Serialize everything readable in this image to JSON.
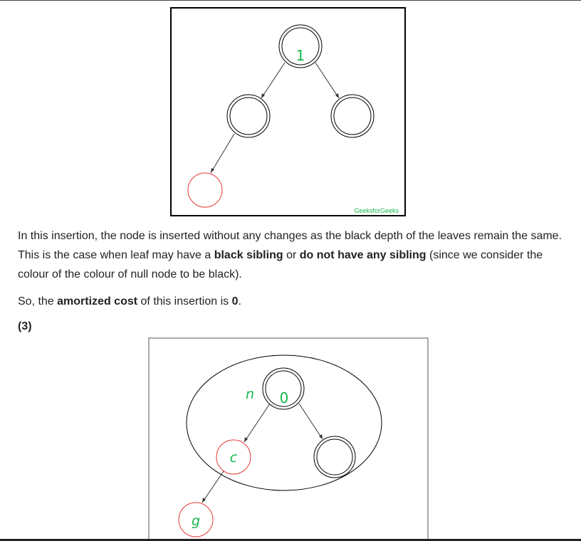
{
  "figure1": {
    "root_label": "1",
    "watermark": "GeeksforGeeks",
    "colors": {
      "node": "#000000",
      "red_node": "#e53935",
      "label": "#17b84a"
    }
  },
  "paragraph1": {
    "t1": "In this insertion, the node is inserted without any changes as the black depth of the leaves remain the same. This is the case when leaf may have a ",
    "b1": "black sibling",
    "t2": " or ",
    "b2": "do not have any sibling",
    "t3": " (since we consider the colour of the colour of null node to be black)."
  },
  "paragraph2": {
    "t1": "So, the ",
    "b1": "amortized cost",
    "t2": " of this insertion is ",
    "b2": "0",
    "t3": "."
  },
  "section_label": "(3)",
  "figure2": {
    "n_label": "n",
    "root_label": "0",
    "c_label": "c",
    "g_label": "g"
  }
}
